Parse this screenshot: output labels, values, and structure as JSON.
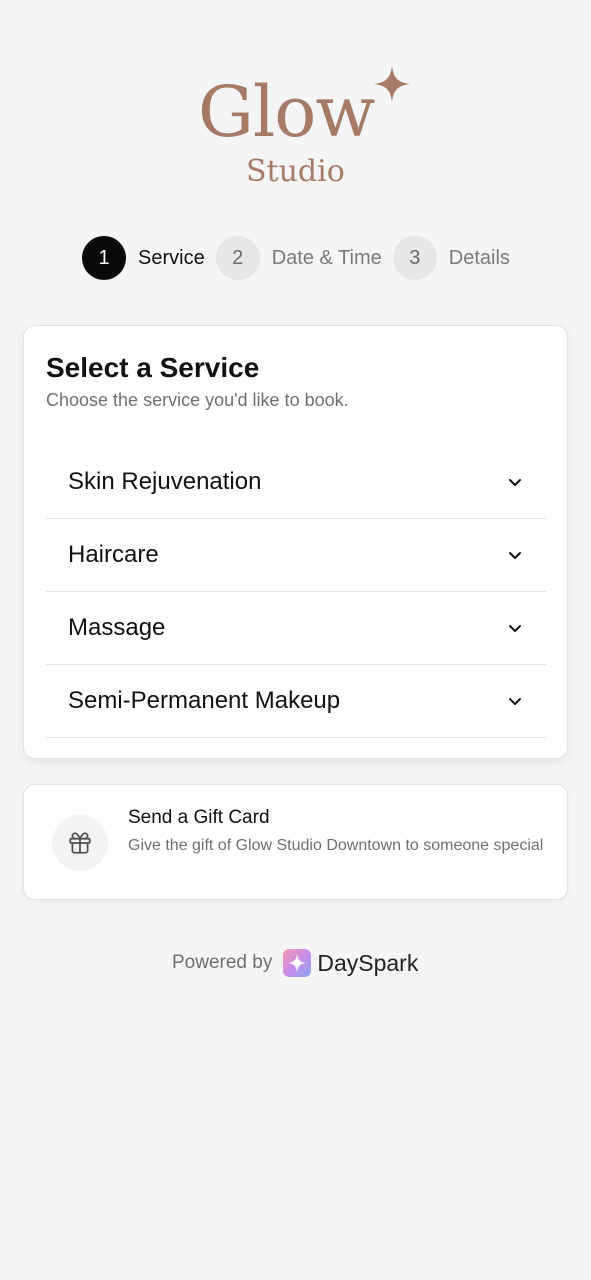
{
  "brand": {
    "name": "Glow",
    "sub": "Studio"
  },
  "stepper": {
    "steps": [
      {
        "number": "1",
        "label": "Service"
      },
      {
        "number": "2",
        "label": "Date & Time"
      },
      {
        "number": "3",
        "label": "Details"
      }
    ],
    "active": "1"
  },
  "service_card": {
    "title": "Select a Service",
    "subtitle": "Choose the service you'd like to book.",
    "services": [
      {
        "name": "Skin Rejuvenation"
      },
      {
        "name": "Haircare"
      },
      {
        "name": "Massage"
      },
      {
        "name": "Semi-Permanent Makeup"
      }
    ]
  },
  "gift_card": {
    "title": "Send a Gift Card",
    "description": "Give the gift of Glow Studio Downtown to someone special"
  },
  "footer": {
    "powered_by": "Powered by",
    "provider": "DaySpark"
  },
  "colors": {
    "brand": "#a57b68",
    "active_step": "#0a0a0a",
    "inactive_step": "#e6e6e8"
  },
  "icons": {
    "chevron": "chevron-down-icon",
    "gift": "gift-icon",
    "sparkle": "sparkle-icon"
  }
}
